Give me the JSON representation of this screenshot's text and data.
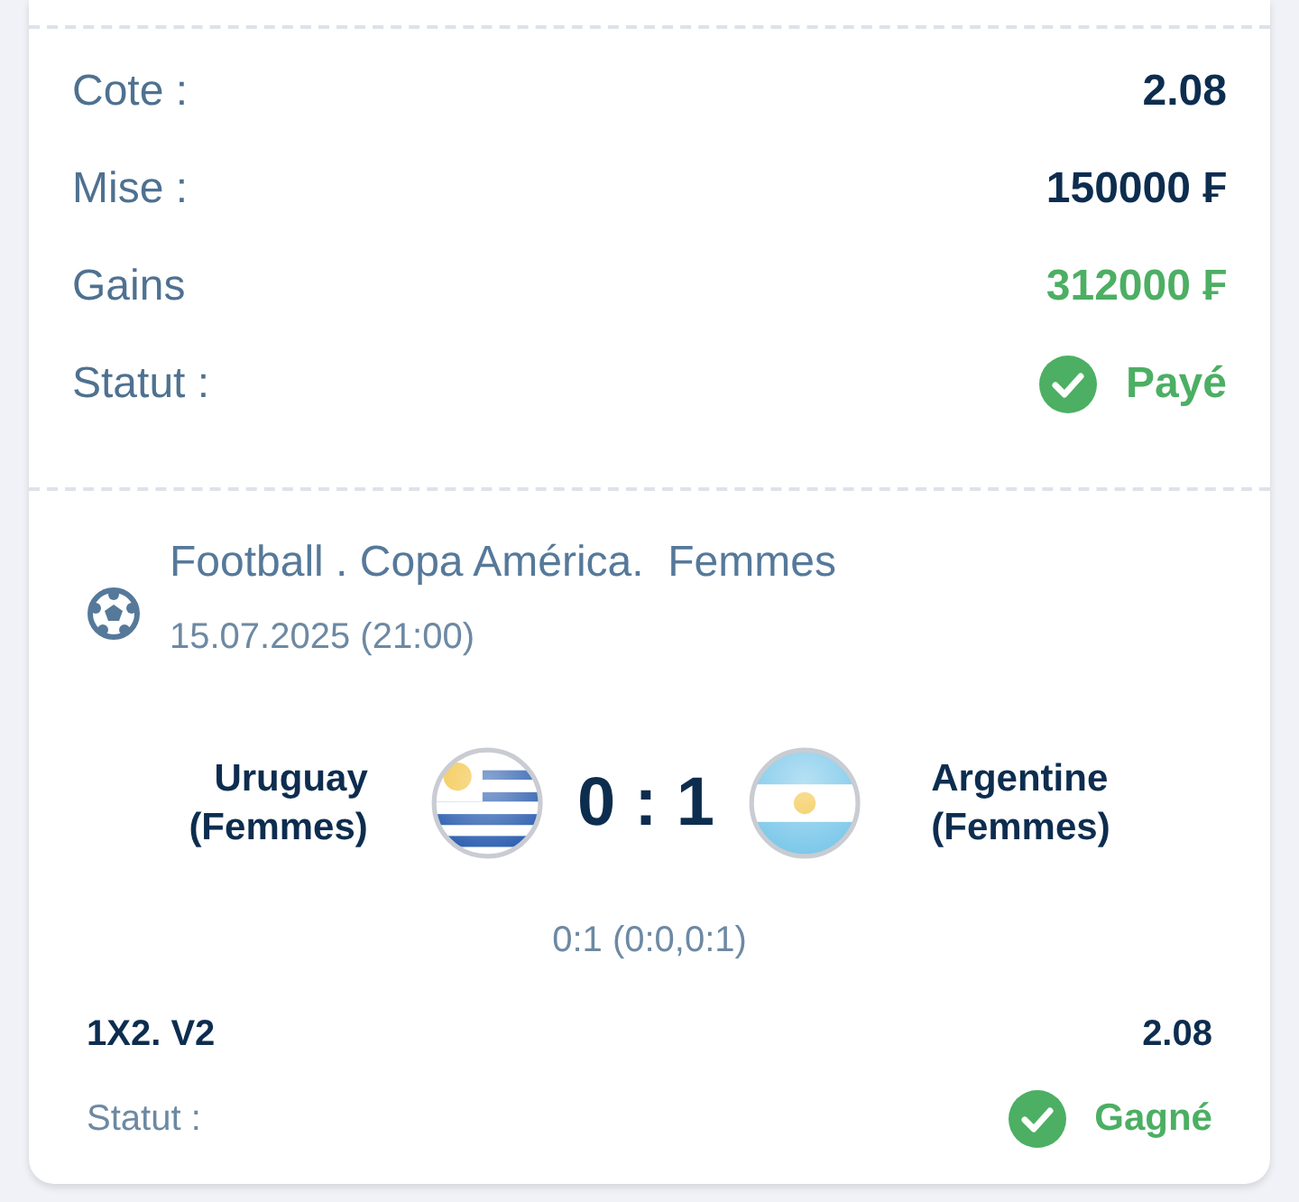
{
  "summary": [
    {
      "label": "Cote :",
      "value": "2.08",
      "kind": "plain"
    },
    {
      "label": "Mise :",
      "value": "150000 ₣",
      "kind": "plain"
    },
    {
      "label": "Gains",
      "value": "312000 ₣",
      "kind": "win"
    },
    {
      "label": "Statut :",
      "value": "Payé",
      "kind": "status"
    }
  ],
  "event": {
    "title": "Football . Copa América.  Femmes",
    "date": "15.07.2025 (21:00)",
    "home": "Uruguay (Femmes)",
    "score": "0 : 1",
    "away": "Argentine (Femmes)",
    "result": "0:1 (0:0,0:1)",
    "bet": "1X2. V2",
    "odds": "2.08",
    "status": {
      "label": "Statut :",
      "value": "Gagné",
      "kind": "status"
    }
  }
}
